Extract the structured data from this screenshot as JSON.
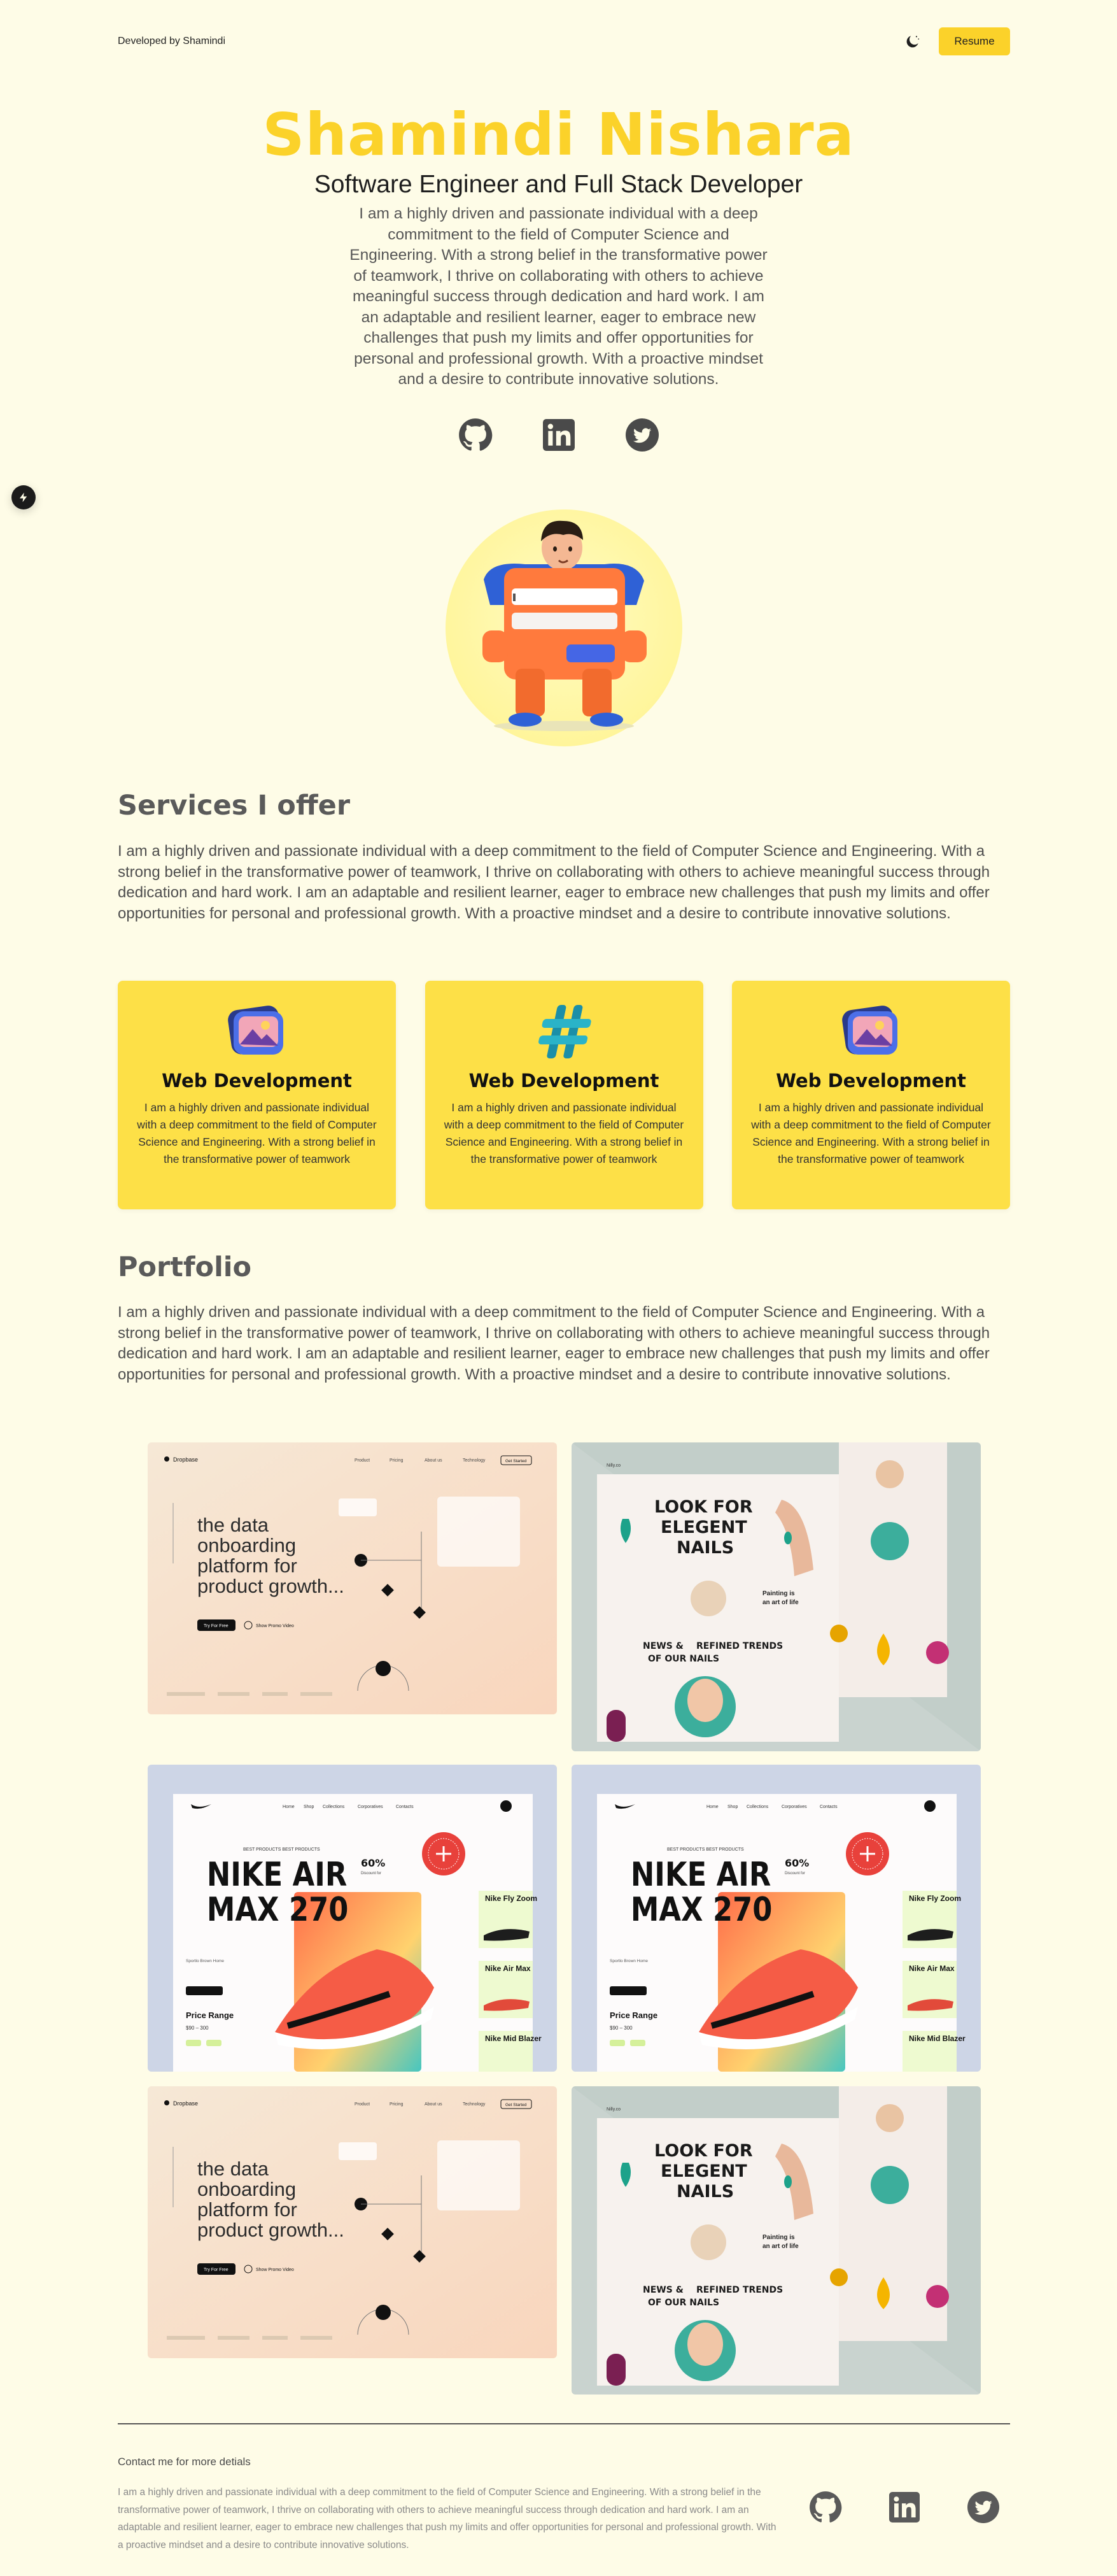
{
  "header": {
    "brand": "Developed by Shamindi",
    "resume_label": "Resume",
    "theme_icon": "moon-icon"
  },
  "hero": {
    "name": "Shamindi Nishara",
    "role": "Software Engineer and Full Stack Developer",
    "bio": "I am a highly driven and passionate individual with a deep commitment to the field of Computer Science and Engineering. With a strong belief in the transformative power of teamwork, I thrive on collaborating with others to achieve meaningful success through dedication and hard work. I am an adaptable and resilient learner, eager to embrace new challenges that push my limits and offer opportunities for personal and professional growth. With a proactive mindset and a desire to contribute innovative solutions.",
    "social_icons": [
      "github-icon",
      "linkedin-icon",
      "twitter-icon"
    ]
  },
  "services": {
    "title": "Services I offer",
    "intro": "I am a highly driven and passionate individual with a deep commitment to the field of Computer Science and Engineering. With a strong belief in the transformative power of teamwork, I thrive on collaborating with others to achieve meaningful success through dedication and hard work. I am an adaptable and resilient learner, eager to embrace new challenges that push my limits and offer opportunities for personal and professional growth. With a proactive mindset and a desire to contribute innovative solutions.",
    "cards": [
      {
        "title": "Web Development",
        "text": "I am a highly driven and passionate individual with a deep commitment to the field of Computer Science and Engineering. With a strong belief in the transformative power of teamwork",
        "icon": "image-gallery-icon"
      },
      {
        "title": "Web Development",
        "text": "I am a highly driven and passionate individual with a deep commitment to the field of Computer Science and Engineering. With a strong belief in the transformative power of teamwork",
        "icon": "hashtag-icon"
      },
      {
        "title": "Web Development",
        "text": "I am a highly driven and passionate individual with a deep commitment to the field of Computer Science and Engineering. With a strong belief in the transformative power of teamwork",
        "icon": "image-gallery-icon"
      }
    ]
  },
  "portfolio": {
    "title": "Portfolio",
    "intro": "I am a highly driven and passionate individual with a deep commitment to the field of Computer Science and Engineering. With a strong belief in the transformative power of teamwork, I thrive on collaborating with others to achieve meaningful success through dedication and hard work. I am an adaptable and resilient learner, eager to embrace new challenges that push my limits and offer opportunities for personal and professional growth. With a proactive mindset and a desire to contribute innovative solutions.",
    "onboarding": {
      "logo": "Dropbase",
      "nav": [
        "Product",
        "Pricing",
        "About us",
        "Technology"
      ],
      "cta": "Get Started",
      "headline": [
        "the data",
        "onboarding",
        "platform for",
        "product growth..."
      ],
      "try": "Try For Free",
      "video": "Show Promo Video"
    },
    "nails": {
      "logo": "Nilly.co",
      "headline": [
        "LOOK FOR",
        "ELEGENT",
        "NAILS"
      ],
      "news": [
        "NEWS & ",
        "REFINED TRENDS",
        "OF OUR NAILS"
      ],
      "art": [
        "Painting is",
        "an art of life"
      ]
    },
    "nike": {
      "nav": [
        "Home",
        "Shop",
        "Collections",
        "Corporatives",
        "Contacts"
      ],
      "eyebrow": "BEST PRODUCTS BEST PRODUCTS",
      "headline": [
        "NIKE AIR",
        "MAX 270"
      ],
      "discount": "60%",
      "discount_sub": "Discount for",
      "price_range": "Price Range",
      "price": "$90 – 300",
      "side": [
        "Nike Fly Zoom",
        "Nike Air Max",
        "Nike Mid Blazer"
      ]
    }
  },
  "footer": {
    "heading": "Contact me for more detials",
    "text": "I am a highly driven and passionate individual with a deep commitment to the field of Computer Science and Engineering. With a strong belief in the transformative power of teamwork, I thrive on collaborating with others to achieve meaningful success through dedication and hard work. I am an adaptable and resilient learner, eager to embrace new challenges that push my limits and offer opportunities for personal and professional growth. With a proactive mindset and a desire to contribute innovative solutions."
  },
  "colors": {
    "background": "#fefce7",
    "accent": "#fbd22a",
    "card": "#fde047",
    "text": "#4e4e4e"
  }
}
